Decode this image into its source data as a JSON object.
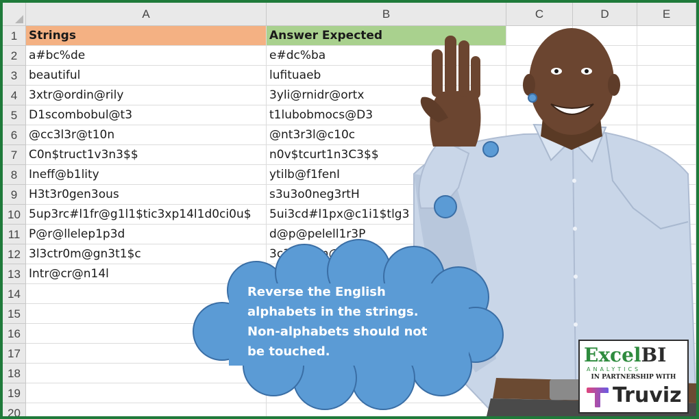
{
  "sheet": {
    "columns": [
      "A",
      "B",
      "C",
      "D",
      "E"
    ],
    "rows": [
      "1",
      "2",
      "3",
      "4",
      "5",
      "6",
      "7",
      "8",
      "9",
      "10",
      "11",
      "12",
      "13",
      "14",
      "15",
      "16",
      "17",
      "18",
      "19",
      "20"
    ],
    "header": {
      "a": "Strings",
      "b": "Answer Expected"
    },
    "data": [
      {
        "a": "a#bc%de",
        "b": "e#dc%ba"
      },
      {
        "a": "beautiful",
        "b": "lufituaeb"
      },
      {
        "a": "3xtr@ordin@rily",
        "b": "3yli@rnidr@ortx"
      },
      {
        "a": "D1scombobul@t3",
        "b": "t1lubobmocs@D3"
      },
      {
        "a": "@cc3l3r@t10n",
        "b": "@nt3r3l@c10c"
      },
      {
        "a": "C0n$truct1v3n3$$",
        "b": "n0v$tcurt1n3C3$$"
      },
      {
        "a": "Ineff@b1lity",
        "b": "ytilb@f1fenI"
      },
      {
        "a": "H3t3r0gen3ous",
        "b": "s3u3o0neg3rtH"
      },
      {
        "a": "5up3rc#l1fr@g1l1$tic3xp14l1d0ci0u$",
        "b": "5ui3cd#l1px@c1i1$tlg3"
      },
      {
        "a": "P@r@llelep1p3d",
        "b": "d@p@pelell1r3P"
      },
      {
        "a": "3l3ctr0m@gn3t1$c",
        "b": "3c3tng0m@rt3c1$l"
      },
      {
        "a": "Intr@cr@n14l",
        "b": ""
      }
    ]
  },
  "bubble": {
    "text": "Reverse the English alphabets in the strings. Non-alphabets should not be touched."
  },
  "logo": {
    "brand_main": "Excel",
    "brand_bi": "BI",
    "tagline": "ANALYTICS",
    "partnership": "IN PARTNERSHIP WITH",
    "partner_name": "Truviz"
  },
  "colors": {
    "frame_border": "#1f7a3a",
    "header_a": "#f4b183",
    "header_b": "#a9d18e",
    "bubble_fill": "#5b9bd5",
    "bubble_stroke": "#3a6ea5"
  }
}
